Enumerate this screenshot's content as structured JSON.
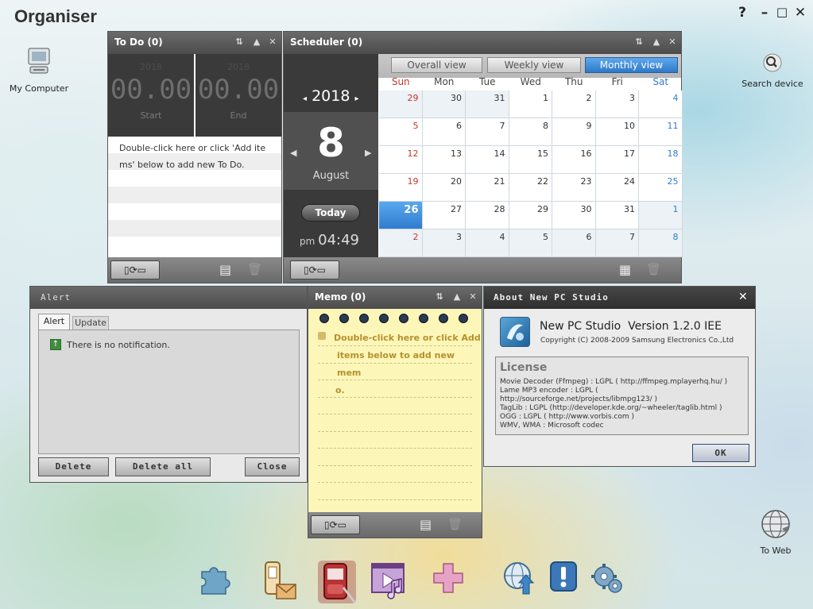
{
  "app": {
    "title": "Organiser"
  },
  "window_controls": {
    "help": "?",
    "minimize": "–",
    "maximize": "□",
    "close": "✕"
  },
  "desktop": {
    "my_computer": {
      "label": "My Computer",
      "icon": "computer-icon"
    },
    "search_device": {
      "label": "Search device",
      "icon": "search-icon"
    },
    "to_web": {
      "label": "To Web",
      "icon": "globe-icon"
    }
  },
  "todo": {
    "title": "To Do (0)",
    "start": {
      "year": "2018",
      "time": "00.00",
      "label": "Start"
    },
    "end": {
      "year": "2018",
      "time": "00.00",
      "label": "End"
    },
    "hint_line1": "Double-click here or click 'Add ite",
    "hint_line2": "ms' below to add new To Do."
  },
  "scheduler": {
    "title": "Scheduler (0)",
    "year": "2018",
    "day": "8",
    "month": "August",
    "today_label": "Today",
    "ampm": "pm",
    "time": "04:49",
    "tabs": [
      {
        "label": "Overall view",
        "active": false
      },
      {
        "label": "Weekly view",
        "active": false
      },
      {
        "label": "Monthly view",
        "active": true
      }
    ],
    "days": [
      "Sun",
      "Mon",
      "Tue",
      "Wed",
      "Thu",
      "Fri",
      "Sat"
    ],
    "weeks": [
      [
        "29",
        "30",
        "31",
        "1",
        "2",
        "3",
        "4"
      ],
      [
        "5",
        "6",
        "7",
        "8",
        "9",
        "10",
        "11"
      ],
      [
        "12",
        "13",
        "14",
        "15",
        "16",
        "17",
        "18"
      ],
      [
        "19",
        "20",
        "21",
        "22",
        "23",
        "24",
        "25"
      ],
      [
        "26",
        "27",
        "28",
        "29",
        "30",
        "31",
        "1"
      ],
      [
        "2",
        "3",
        "4",
        "5",
        "6",
        "7",
        "8"
      ]
    ],
    "selected": "26"
  },
  "alert": {
    "title": "Alert",
    "tabs": [
      "Alert",
      "Update"
    ],
    "message": "There is no notification.",
    "buttons": {
      "delete": "Delete",
      "delete_all": "Delete all",
      "close": "Close"
    }
  },
  "memo": {
    "title": "Memo (0)",
    "hint_line1": "Double-click here or click Add",
    "hint_line2": "items below to add new mem",
    "hint_line3": "o."
  },
  "about": {
    "title": "About New PC Studio",
    "product": "New PC Studio  Version 1.2.0 IEE",
    "copyright": "Copyright (C) 2008-2009 Samsung Electronics Co.,Ltd",
    "license_title": "License",
    "license_lines": [
      "Movie Decoder (Ffmpeg) : LGPL ( http://ffmpeg.mplayerhq.hu/ )",
      "Lame MP3 encoder : LGPL ( http://sourceforge.net/projects/libmpg123/ )",
      "TagLib : LGPL (http://developer.kde.org/~wheeler/taglib.html )",
      "OGG : LGPL ( http://www.vorbis.com )",
      "WMV, WMA : Microsoft codec"
    ],
    "ok": "OK"
  },
  "dock": {
    "items": [
      {
        "name": "puzzle-icon"
      },
      {
        "name": "phone-message-icon"
      },
      {
        "name": "organiser-icon"
      },
      {
        "name": "multimedia-icon"
      },
      {
        "name": "add-plus-icon"
      },
      {
        "name": "web-upload-icon"
      },
      {
        "name": "alert-icon"
      },
      {
        "name": "settings-icon"
      }
    ]
  }
}
